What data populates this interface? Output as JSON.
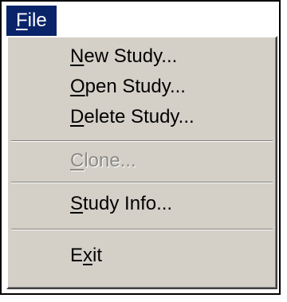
{
  "menubar": {
    "file": {
      "mnemonic": "F",
      "rest": "ile"
    }
  },
  "menu": {
    "new_study": {
      "mnemonic": "N",
      "rest": "ew Study..."
    },
    "open_study": {
      "mnemonic": "O",
      "rest": "pen Study..."
    },
    "delete_study": {
      "mnemonic": "D",
      "rest": "elete Study..."
    },
    "clone": {
      "mnemonic": "C",
      "rest": "lone...",
      "enabled": false
    },
    "study_info": {
      "mnemonic": "S",
      "rest": "tudy Info..."
    },
    "exit": {
      "before": "E",
      "mnemonic": "x",
      "rest": "it"
    }
  },
  "colors": {
    "menu_highlight": "#0a246a",
    "menu_background": "#d4d0c8",
    "disabled_text": "#8c8a85"
  }
}
